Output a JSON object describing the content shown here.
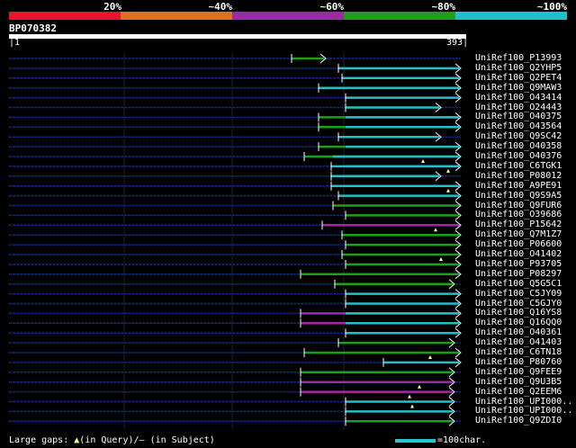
{
  "legend": {
    "labels": [
      "20%",
      "~40%",
      "~60%",
      "~80%",
      "~100%"
    ],
    "colors": [
      "#e8142c",
      "#e0701c",
      "#9c2aa0",
      "#1aa01a",
      "#20c0c8"
    ]
  },
  "query": {
    "name": "BP070382",
    "start": "1",
    "end": "393"
  },
  "hits": [
    "UniRef100_P13993",
    "UniRef100_Q2YHP5",
    "UniRef100_Q2PET4",
    "UniRef100_Q9MAW3",
    "UniRef100_O43414",
    "UniRef100_O24443",
    "UniRef100_O40375",
    "UniRef100_O43564",
    "UniRef100_Q9SC42",
    "UniRef100_O40358",
    "UniRef100_O40376",
    "UniRef100_C6TGK1",
    "UniRef100_P08012",
    "UniRef100_A9PE91",
    "UniRef100_Q9S9A5",
    "UniRef100_Q9FUR6",
    "UniRef100_O39686",
    "UniRef100_P15642",
    "UniRef100_Q7M1Z7",
    "UniRef100_P06600",
    "UniRef100_O41402",
    "UniRef100_P93705",
    "UniRef100_P08297",
    "UniRef100_Q5G5C1",
    "UniRef100_C5JY09",
    "UniRef100_C5GJY0",
    "UniRef100_Q16YS8",
    "UniRef100_Q16QQ0",
    "UniRef100_O40361",
    "UniRef100_O41403",
    "UniRef100_C6TN18",
    "UniRef100_P80760",
    "UniRef100_Q9FEE9",
    "UniRef100_Q9U3B5",
    "UniRef100_Q2EEM6",
    "UniRef100_UPI000..",
    "UniRef100_UPI000..",
    "UniRef100_Q9ZDI0"
  ],
  "footer": {
    "gaps_label": "Large gaps: ",
    "gap_query_glyph": "▲",
    "in_query": "(in Query)/",
    "gap_subject_glyph": "‒",
    "in_subject": " (in Subject)",
    "scale_label": "=100char."
  }
}
